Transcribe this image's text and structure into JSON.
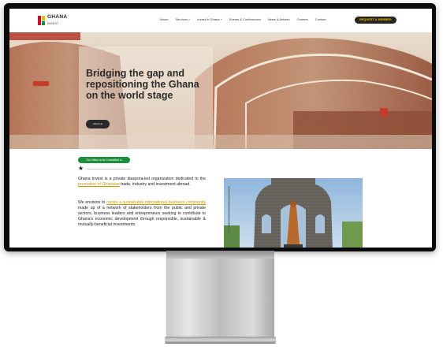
{
  "nav": {
    "logo_line1": "GHANA",
    "logo_line2": "INVEST",
    "menu": [
      "About",
      "Services ˅",
      "Invest In Ghana ˅",
      "Events & Conferences",
      "News & Articles",
      "Careers",
      "Contact"
    ],
    "cta": "REQUEST A MEMBER"
  },
  "hero": {
    "title": "Bridging the gap and repositioning the Ghana on the world stage",
    "button": "About Us"
  },
  "content": {
    "pill": "Our Vision to be Committed to",
    "para1_a": "Ghana Invest is a private diaspora-led organization dedicated to the ",
    "para1_link": "promotion of Ghanaian",
    "para1_b": " trade, industry and investment abroad.",
    "para2_a": "We envision to ",
    "para2_link": "create a sustainable international business community",
    "para2_b": " made up of a network of stakeholders from the public and private sectors, business leaders and entrepreneurs seeking to contribute to Ghana's economic development through responsible, sustainable & mutually-beneficial investments."
  },
  "colors": {
    "accent_green": "#1e8f3c",
    "accent_yellow": "#f2c200",
    "dark": "#2a2520"
  }
}
